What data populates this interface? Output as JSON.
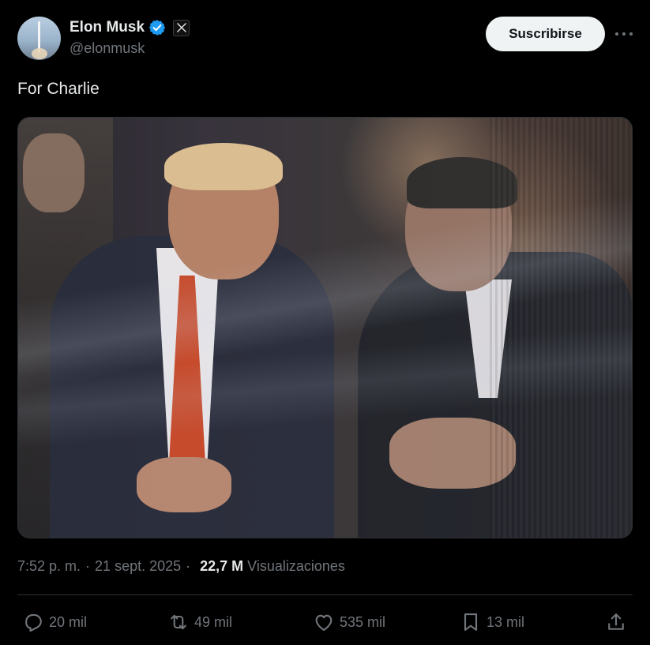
{
  "author": {
    "display_name": "Elon Musk",
    "handle": "@elonmusk",
    "verified_icon": "verified-badge-icon",
    "affiliation_icon": "x-logo-icon"
  },
  "header": {
    "subscribe_label": "Suscribirse",
    "more_icon": "more-dots-icon"
  },
  "tweet": {
    "text": "For Charlie"
  },
  "meta": {
    "time": "7:52 p. m.",
    "date": "21 sept. 2025",
    "separator": "·",
    "views_count": "22,7 M",
    "views_label": "Visualizaciones"
  },
  "actions": {
    "replies": "20 mil",
    "retweets": "49 mil",
    "likes": "535 mil",
    "bookmarks": "13 mil"
  },
  "colors": {
    "background": "#000000",
    "text_primary": "#e7e9ea",
    "text_secondary": "#71767b",
    "verified_blue": "#1d9bf0",
    "button_bg": "#eff3f4",
    "divider": "#2f3336"
  }
}
